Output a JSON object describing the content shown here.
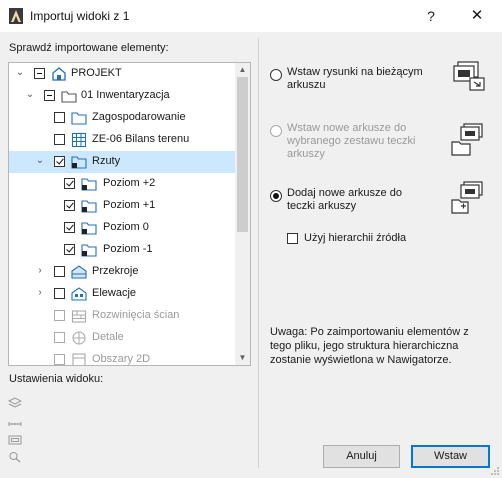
{
  "window": {
    "title": "Importuj widoki z 1",
    "help_label": "?",
    "close_label": "✕"
  },
  "tree": {
    "label": "Sprawdź importowane elementy:",
    "items": [
      {
        "label": "PROJEKT",
        "icon": "project-icon",
        "state": "partial",
        "expanded": true
      },
      {
        "label": "01 Inwentaryzacja",
        "icon": "folder-icon",
        "state": "partial",
        "expanded": true
      },
      {
        "label": "Zagospodarowanie",
        "icon": "view-folder-icon",
        "state": "unchecked"
      },
      {
        "label": "ZE-06 Bilans terenu",
        "icon": "table-icon",
        "state": "unchecked"
      },
      {
        "label": "Rzuty",
        "icon": "view-folder-icon",
        "state": "checked",
        "expanded": true,
        "selected": true
      },
      {
        "label": "Poziom +2",
        "icon": "view-folder-icon",
        "state": "checked"
      },
      {
        "label": "Poziom +1",
        "icon": "view-folder-icon",
        "state": "checked"
      },
      {
        "label": "Poziom 0",
        "icon": "view-folder-icon",
        "state": "checked"
      },
      {
        "label": "Poziom -1",
        "icon": "view-folder-icon",
        "state": "checked"
      },
      {
        "label": "Przekroje",
        "icon": "section-icon",
        "state": "unchecked",
        "expanded": false
      },
      {
        "label": "Elewacje",
        "icon": "elevation-icon",
        "state": "unchecked",
        "expanded": false
      },
      {
        "label": "Rozwinięcia ścian",
        "icon": "wall-icon",
        "state": "disabled"
      },
      {
        "label": "Detale",
        "icon": "detail-icon",
        "state": "disabled"
      },
      {
        "label": "Obszary 2D",
        "icon": "worksheet-icon",
        "state": "disabled"
      }
    ]
  },
  "view_settings": {
    "label": "Ustawienia widoku:",
    "icons": [
      "layers-icon",
      "dimension-icon",
      "frame-icon",
      "zoom-icon"
    ]
  },
  "options": [
    {
      "label": "Wstaw rysunki na bieżącym arkuszu",
      "selected": false,
      "enabled": true,
      "icon": "place-drawings-icon"
    },
    {
      "label": "Wstaw nowe arkusze do wybranego zestawu teczki arkuszy",
      "selected": false,
      "enabled": false,
      "icon": "subset-layouts-icon"
    },
    {
      "label": "Dodaj nowe arkusze do teczki arkuszy",
      "selected": true,
      "enabled": true,
      "icon": "new-layouts-icon"
    }
  ],
  "hierarchy_checkbox": {
    "label": "Użyj hierarchii źródła",
    "checked": false
  },
  "note": "Uwaga: Po zaimportowaniu elementów z tego pliku, jego struktura hierarchiczna zostanie wyświetlona w Nawigatorze.",
  "buttons": {
    "cancel": "Anuluj",
    "ok": "Wstaw"
  },
  "colors": {
    "selection": "#cce8ff",
    "icon_blue": "#1f6fbf",
    "accent": "#0078d7"
  }
}
